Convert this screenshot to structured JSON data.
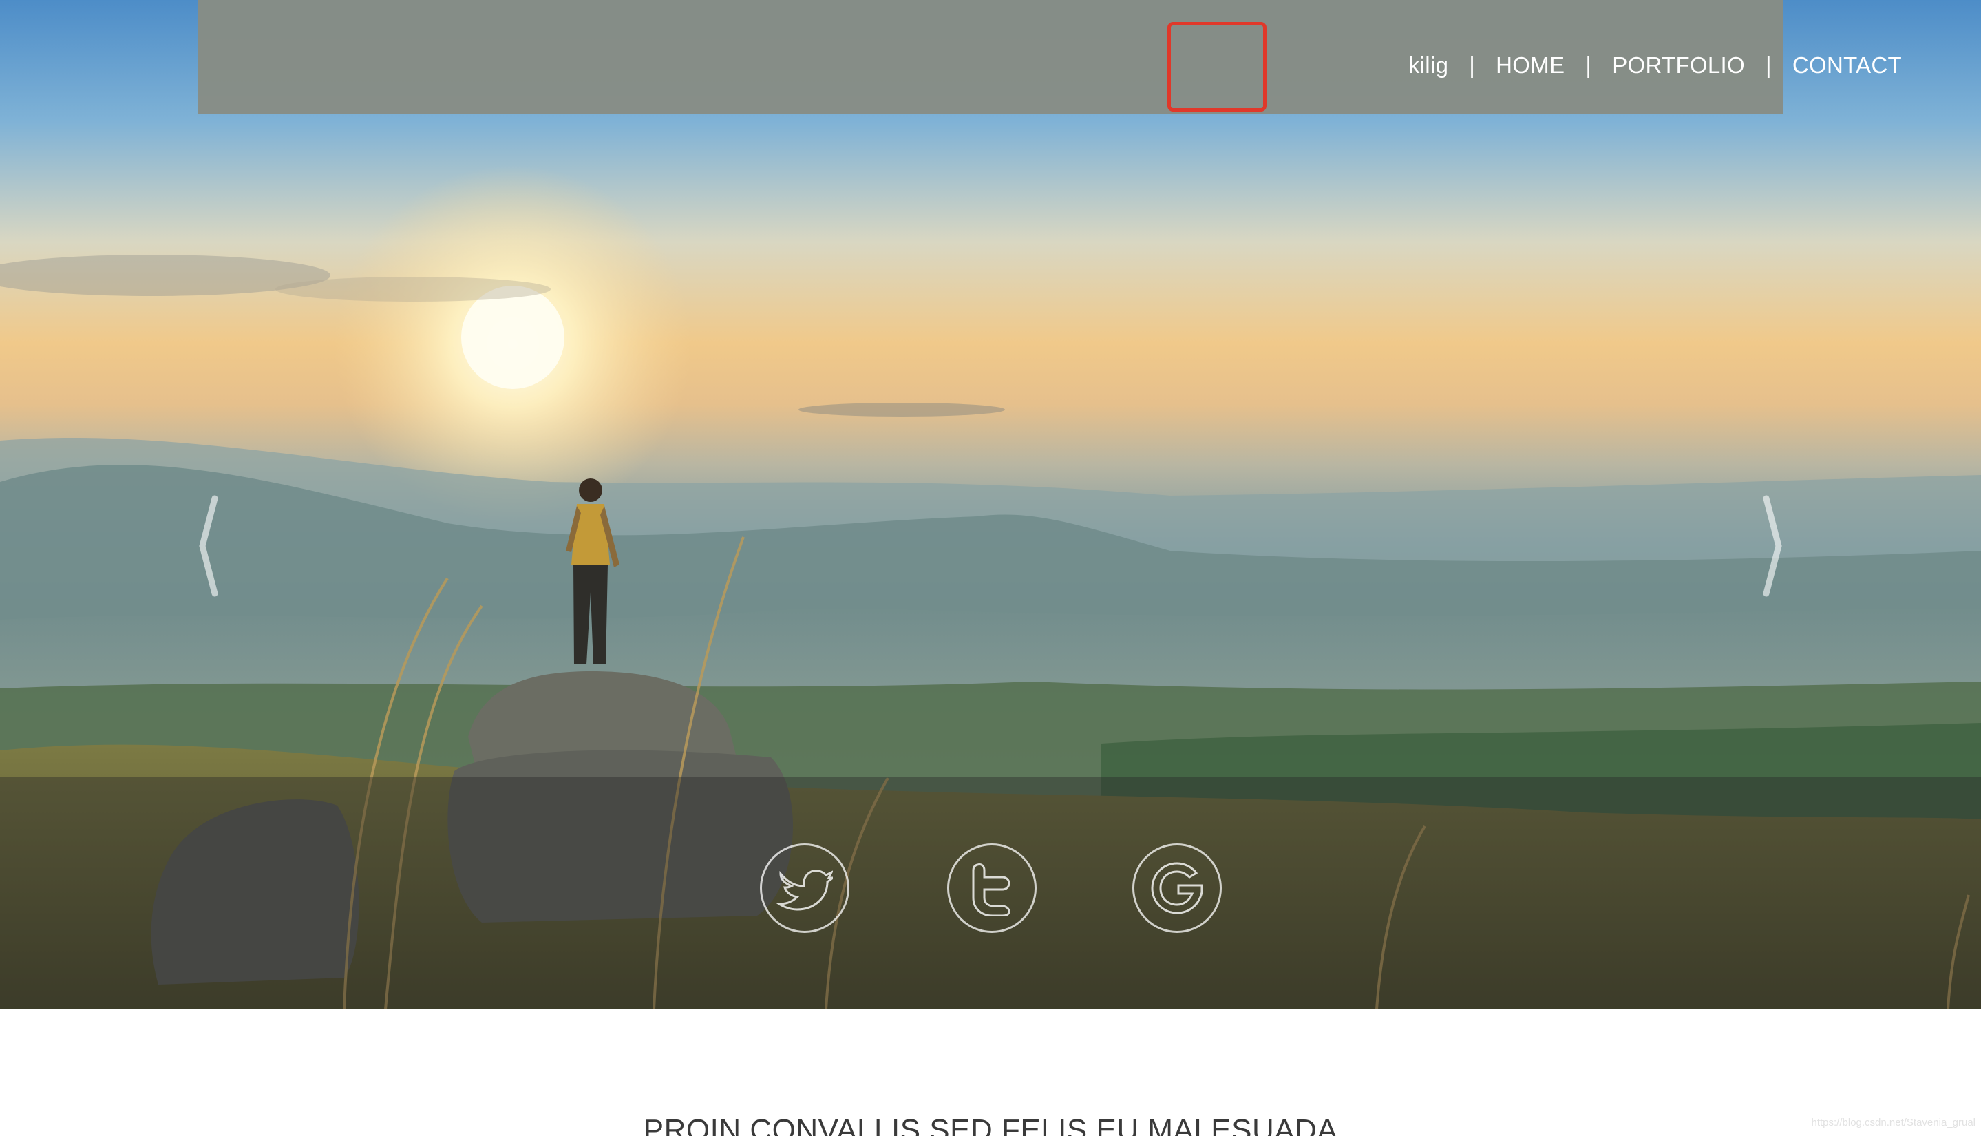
{
  "nav": {
    "brand": "kilig",
    "separator": "|",
    "items": [
      {
        "label": "HOME"
      },
      {
        "label": "PORTFOLIO"
      },
      {
        "label": "CONTACT"
      }
    ]
  },
  "carousel": {
    "prev_icon": "chevron-left-icon",
    "next_icon": "chevron-right-icon"
  },
  "social": [
    {
      "icon": "bird-icon"
    },
    {
      "icon": "twitter-t-icon"
    },
    {
      "icon": "google-icon"
    }
  ],
  "content": {
    "heading": "PROIN CONVALLIS SED FELIS EU MALESUADA"
  },
  "watermark": "https://blog.csdn.net/Stavenia_grual",
  "colors": {
    "topbar": "#878c84",
    "highlight": "#e0382a",
    "nav_text": "#ffffff",
    "heading_text": "#3a3a3a"
  }
}
